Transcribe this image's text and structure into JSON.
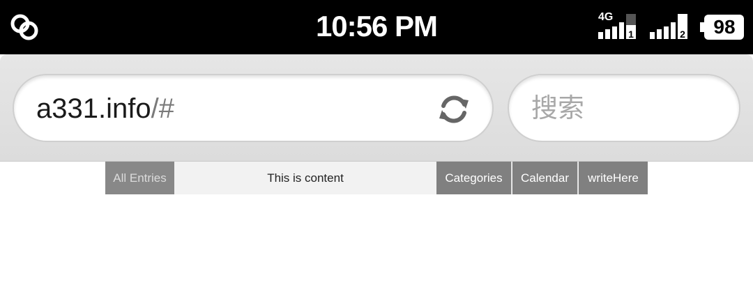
{
  "status_bar": {
    "time": "10:56 PM",
    "network_type": "4G",
    "sim1_label": "1",
    "sim2_label": "2",
    "battery_level": "98",
    "icons": [
      "link-app-icon",
      "signal-icon",
      "signal-icon",
      "battery-icon"
    ]
  },
  "browser": {
    "url_main": "a331.info",
    "url_hash": "/#",
    "search_placeholder": "搜索",
    "icons": [
      "reload-icon"
    ]
  },
  "nav": {
    "all_entries": "All Entries",
    "content": "This is content",
    "categories": "Categories",
    "calendar": "Calendar",
    "write_here": "writeHere"
  },
  "colors": {
    "status_bar_bg": "#000000",
    "nav_active_bg": "#808080",
    "nav_bar_bg": "#f2f2f2"
  }
}
